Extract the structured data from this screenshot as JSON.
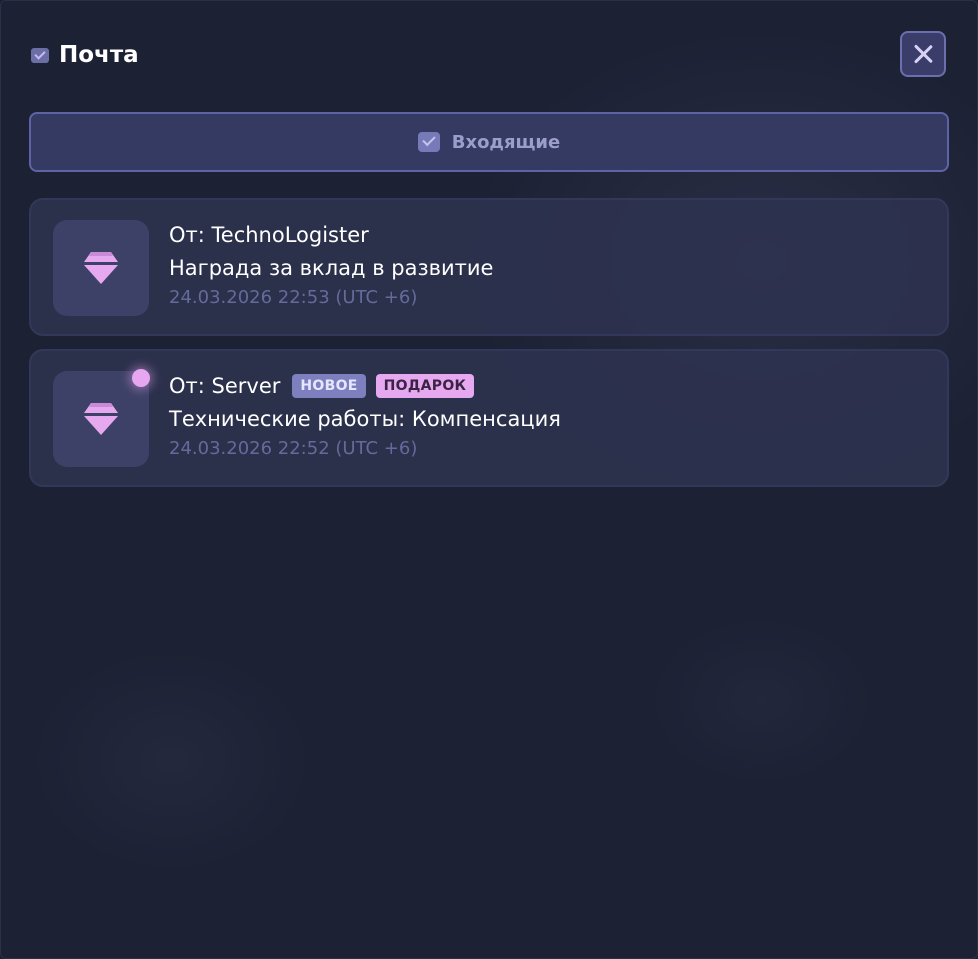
{
  "window": {
    "title": "Почта",
    "title_icon": "mail-icon",
    "close_icon": "close-icon"
  },
  "tabs": [
    {
      "label": "Входящие",
      "icon": "mail-icon",
      "active": true
    }
  ],
  "mails": [
    {
      "sender": "От: TechnoLogister",
      "subject": "Награда за вклад в развитие",
      "timestamp": "24.03.2026 22:53 (UTC +6)",
      "icon": "gem-icon",
      "unread": false,
      "badges": []
    },
    {
      "sender": "От: Server",
      "subject": "Технические работы: Компенсация",
      "timestamp": "24.03.2026 22:52 (UTC +6)",
      "icon": "gem-icon",
      "unread": true,
      "badges": [
        "НОВОЕ",
        "ПОДАРОК"
      ]
    }
  ],
  "colors": {
    "background": "#1d2134",
    "accent": "#5d63a6",
    "badge_new": "#7d7fbf",
    "badge_gift": "#e6a8ee",
    "gem": "#e6a8ee",
    "unread_dot": "#e7a6f0"
  }
}
